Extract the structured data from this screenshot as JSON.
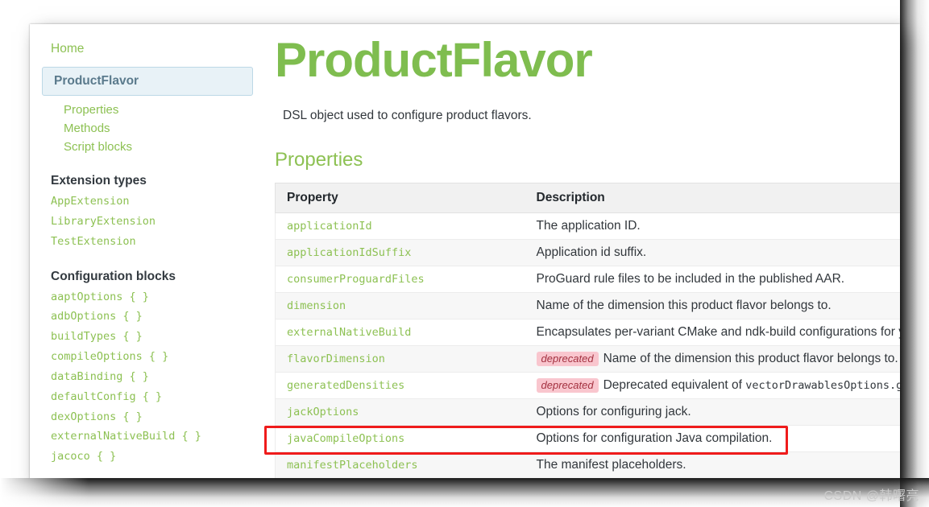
{
  "sidebar": {
    "home_label": "Home",
    "current_label": "ProductFlavor",
    "sub_links": [
      {
        "label": "Properties"
      },
      {
        "label": "Methods"
      },
      {
        "label": "Script blocks"
      }
    ],
    "extension_types_heading": "Extension types",
    "extension_types": [
      {
        "label": "AppExtension"
      },
      {
        "label": "LibraryExtension"
      },
      {
        "label": "TestExtension"
      }
    ],
    "configuration_blocks_heading": "Configuration blocks",
    "configuration_blocks": [
      {
        "label": "aaptOptions { }"
      },
      {
        "label": "adbOptions { }"
      },
      {
        "label": "buildTypes { }"
      },
      {
        "label": "compileOptions { }"
      },
      {
        "label": "dataBinding { }"
      },
      {
        "label": "defaultConfig { }"
      },
      {
        "label": "dexOptions { }"
      },
      {
        "label": "externalNativeBuild { }"
      },
      {
        "label": "jacoco { }"
      }
    ]
  },
  "main": {
    "title": "ProductFlavor",
    "description": "DSL object used to configure product flavors.",
    "section_title": "Properties",
    "table": {
      "columns": [
        "Property",
        "Description"
      ],
      "rows": [
        {
          "property": "applicationId",
          "deprecated": false,
          "description": "The application ID.",
          "code_suffix": ""
        },
        {
          "property": "applicationIdSuffix",
          "deprecated": false,
          "description": "Application id suffix.",
          "code_suffix": ""
        },
        {
          "property": "consumerProguardFiles",
          "deprecated": false,
          "description": "ProGuard rule files to be included in the published AAR.",
          "code_suffix": ""
        },
        {
          "property": "dimension",
          "deprecated": false,
          "description": "Name of the dimension this product flavor belongs to.",
          "code_suffix": ""
        },
        {
          "property": "externalNativeBuild",
          "deprecated": false,
          "description": "Encapsulates per-variant CMake and ndk-build configurations for y",
          "code_suffix": ""
        },
        {
          "property": "flavorDimension",
          "deprecated": true,
          "description": "Name of the dimension this product flavor belongs to. ",
          "code_suffix": ""
        },
        {
          "property": "generatedDensities",
          "deprecated": true,
          "description": "Deprecated equivalent of ",
          "code_suffix": "vectorDrawablesOptions.gene"
        },
        {
          "property": "jackOptions",
          "deprecated": false,
          "description": "Options for configuring jack.",
          "code_suffix": ""
        },
        {
          "property": "javaCompileOptions",
          "deprecated": false,
          "description": "Options for configuration Java compilation.",
          "code_suffix": ""
        },
        {
          "property": "manifestPlaceholders",
          "deprecated": false,
          "description": "The manifest placeholders.",
          "code_suffix": ""
        }
      ]
    },
    "deprecated_badge_label": "deprecated"
  },
  "annotation": {
    "highlight_target": "javaCompileOptions"
  },
  "watermark": {
    "text": "CSDN @韩曙亮"
  },
  "colors": {
    "link_green": "#8dc153",
    "title_green": "#7fbd4f",
    "highlight_red": "#ef1b1b",
    "deprecated_bg": "#f9c6ce",
    "deprecated_fg": "#a3303f",
    "current_nav_bg": "#e8f2f7"
  }
}
